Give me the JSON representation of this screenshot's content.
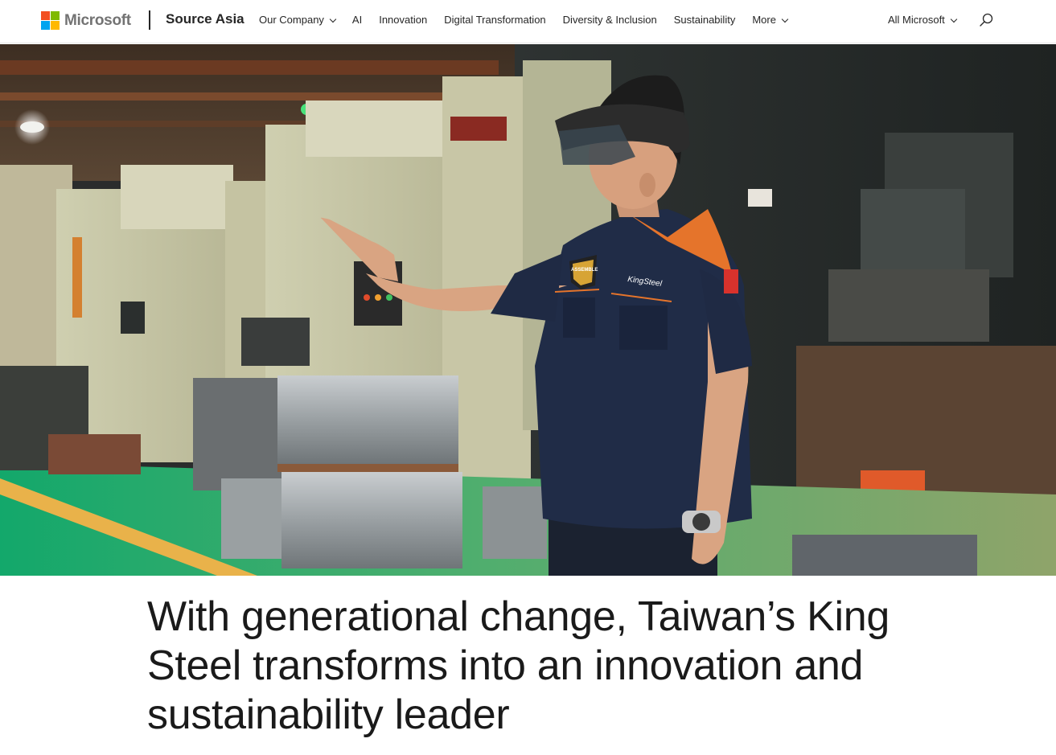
{
  "header": {
    "brand": "Microsoft",
    "site_name": "Source Asia",
    "nav": [
      {
        "label": "Our Company",
        "has_dropdown": true
      },
      {
        "label": "AI",
        "has_dropdown": false
      },
      {
        "label": "Innovation",
        "has_dropdown": false
      },
      {
        "label": "Digital Transformation",
        "has_dropdown": false
      },
      {
        "label": "Diversity & Inclusion",
        "has_dropdown": false
      },
      {
        "label": "Sustainability",
        "has_dropdown": false
      },
      {
        "label": "More",
        "has_dropdown": true
      }
    ],
    "all_microsoft": "All Microsoft",
    "search_icon": "search-icon"
  },
  "logo_colors": [
    "#f25022",
    "#7fba00",
    "#00a4ef",
    "#ffb900"
  ],
  "hero": {
    "badge_left": "ASSEMBLE",
    "badge_right": "KingSteel"
  },
  "article": {
    "headline": "With generational change, Taiwan’s King Steel transforms into an innovation and sustainability leader"
  }
}
